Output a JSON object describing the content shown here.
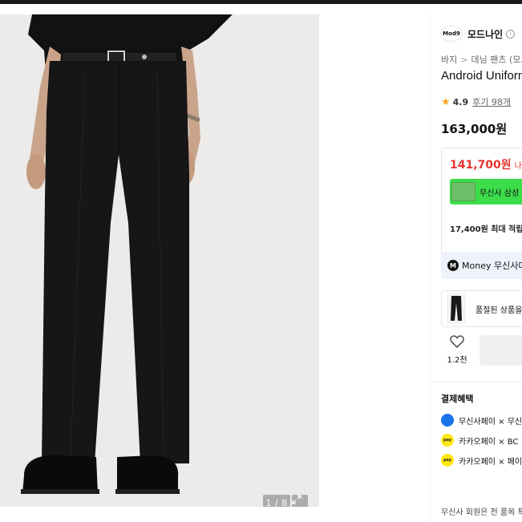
{
  "image_viewer": {
    "counter": "1 / 8"
  },
  "brand": {
    "logo_text": "Mod9",
    "name": "모드나인",
    "info_symbol": "i"
  },
  "breadcrumb": {
    "items": [
      "바지",
      "데님 팬츠 (모드나"
    ],
    "separator": ">"
  },
  "product": {
    "title": "Android Uniform",
    "rating": "4.9",
    "review_text": "후기 98개",
    "price": "163,000원"
  },
  "benefit": {
    "price": "141,700원",
    "price_suffix": "나의",
    "card_text": "무신사 삼성",
    "points": "17,400원 최대 적립"
  },
  "money": {
    "icon_letter": "M",
    "text": "Money 무신사머"
  },
  "soldout": {
    "text": "품절된 상품을"
  },
  "like": {
    "count": "1.2천"
  },
  "payment": {
    "title": "결제혜택",
    "rows": [
      {
        "text": "무신사페이 × 무신",
        "icon": "musinsa-pay-icon",
        "color": "#1a73e8"
      },
      {
        "text": "카카오페이 × BC",
        "icon": "kakao-pay-icon",
        "color": "#ffe812"
      },
      {
        "text": "카카오페이 × 페이",
        "icon": "kakao-pay-icon",
        "color": "#ffe812"
      }
    ],
    "pay_badge": "pay"
  },
  "footer": {
    "text": "무신사 회원은 전 품목 특"
  },
  "colors": {
    "sale_red": "#e8342f",
    "card_green": "#3ddc4a",
    "star": "#f5a623"
  }
}
